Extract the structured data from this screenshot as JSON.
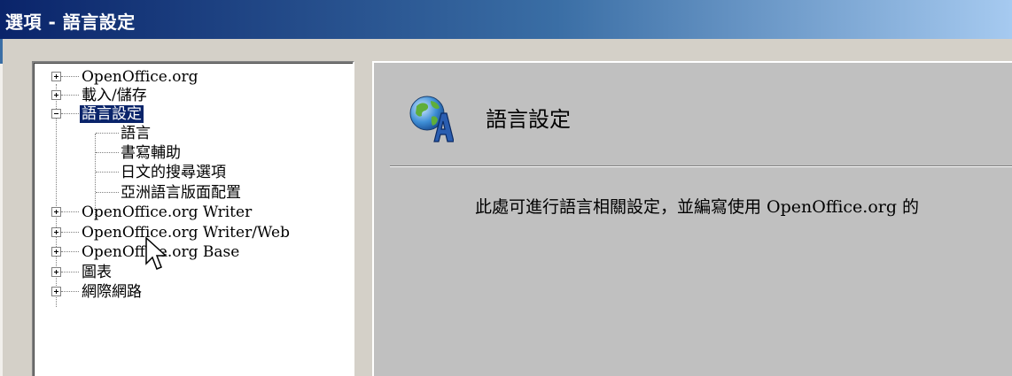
{
  "window": {
    "title": "選項 - 語言設定"
  },
  "tree": {
    "items": [
      {
        "label": "OpenOffice.org",
        "level": 0,
        "expander": "plus"
      },
      {
        "label": "載入/儲存",
        "level": 0,
        "expander": "plus"
      },
      {
        "label": "語言設定",
        "level": 0,
        "expander": "minus",
        "selected": true
      },
      {
        "label": "語言",
        "level": 1
      },
      {
        "label": "書寫輔助",
        "level": 1
      },
      {
        "label": "日文的搜尋選項",
        "level": 1
      },
      {
        "label": "亞洲語言版面配置",
        "level": 1
      },
      {
        "label": "OpenOffice.org Writer",
        "level": 0,
        "expander": "plus"
      },
      {
        "label": "OpenOffice.org Writer/Web",
        "level": 0,
        "expander": "plus"
      },
      {
        "label": "OpenOffice.org Base",
        "level": 0,
        "expander": "plus"
      },
      {
        "label": "圖表",
        "level": 0,
        "expander": "plus"
      },
      {
        "label": "網際網路",
        "level": 0,
        "expander": "plus"
      }
    ]
  },
  "content": {
    "heading": "語言設定",
    "description": "此處可進行語言相關設定，並編寫使用 OpenOffice.org 的",
    "icon": "globe-letter-a-icon"
  },
  "colors": {
    "title_bar_start": "#0a246a",
    "title_bar_end": "#a6caf0",
    "selection": "#0a246a",
    "panel_bg": "#c0c0c0"
  }
}
